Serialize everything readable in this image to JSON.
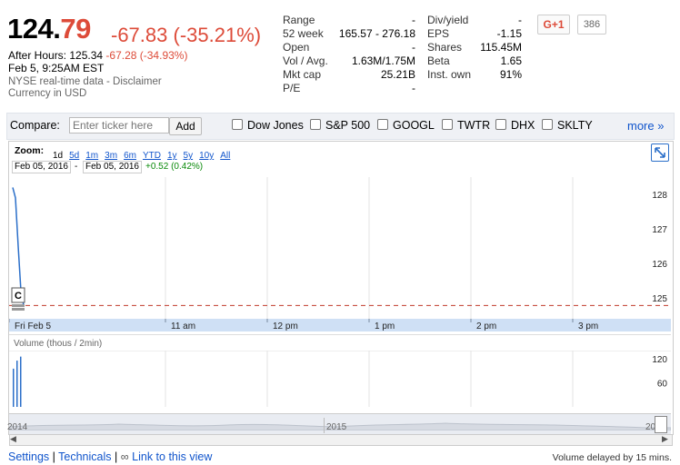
{
  "quote": {
    "price_whole": "124.",
    "price_cents": "79",
    "change": "-67.83 (-35.21%)",
    "after_hours_label": "After Hours: 125.34",
    "after_hours_change": "-67.28 (-34.93%)",
    "timestamp": "Feb 5, 9:25AM EST",
    "data_note": "NYSE real-time data - Disclaimer",
    "currency": "Currency in USD"
  },
  "stats_left": [
    {
      "label": "Range",
      "value": "-"
    },
    {
      "label": "52 week",
      "value": "165.57 - 276.18"
    },
    {
      "label": "Open",
      "value": "-"
    },
    {
      "label": "Vol / Avg.",
      "value": "1.63M/1.75M"
    },
    {
      "label": "Mkt cap",
      "value": "25.21B"
    },
    {
      "label": "P/E",
      "value": "-"
    }
  ],
  "stats_right": [
    {
      "label": "Div/yield",
      "value": "-"
    },
    {
      "label": "EPS",
      "value": "-1.15"
    },
    {
      "label": "Shares",
      "value": "115.45M"
    },
    {
      "label": "Beta",
      "value": "1.65"
    },
    {
      "label": "Inst. own",
      "value": "91%"
    }
  ],
  "social": {
    "gplus_label": "G+1",
    "gplus_count": "386"
  },
  "compare": {
    "label": "Compare:",
    "placeholder": "Enter ticker here",
    "add_label": "Add",
    "tickers": [
      "Dow Jones",
      "S&P 500",
      "GOOGL",
      "TWTR",
      "DHX",
      "SKLTY"
    ],
    "more_label": "more »"
  },
  "chart": {
    "zoom_label": "Zoom:",
    "zoom_options": [
      "1d",
      "5d",
      "1m",
      "3m",
      "6m",
      "YTD",
      "1y",
      "5y",
      "10y",
      "All"
    ],
    "zoom_selected": "1d",
    "date_from": "Feb 05, 2016",
    "date_sep": "-",
    "date_to": "Feb 05, 2016",
    "range_change": "+0.52 (0.42%)",
    "y_ticks": [
      "128",
      "127",
      "126",
      "125"
    ],
    "x_ticks": [
      "Fri Feb 5",
      "11 am",
      "12 pm",
      "1 pm",
      "2 pm",
      "3 pm"
    ],
    "marker_label": "C",
    "volume_label": "Volume (thous / 2min)",
    "volume_ticks": [
      "120",
      "60"
    ],
    "nav_ticks": [
      "2014",
      "2015",
      "2016"
    ]
  },
  "chart_data": {
    "type": "line",
    "ylim": [
      124.5,
      128.5
    ],
    "y_ticks": [
      128,
      127,
      126,
      125
    ],
    "x_ticks": [
      "Fri Feb 5",
      "11 am",
      "12 pm",
      "1 pm",
      "2 pm",
      "3 pm"
    ],
    "series": [
      {
        "values": [
          128.2,
          127.9,
          126.5,
          125.2
        ]
      }
    ],
    "reference_line": 124.78,
    "volume": {
      "label": "Volume (thous / 2min)",
      "ticks": [
        120,
        60
      ],
      "values": [
        95,
        115,
        125
      ]
    }
  },
  "footer": {
    "settings": "Settings",
    "sep": "|",
    "technicals": "Technicals",
    "link_view": "Link to this view",
    "delay_note": "Volume delayed by 15 mins."
  }
}
